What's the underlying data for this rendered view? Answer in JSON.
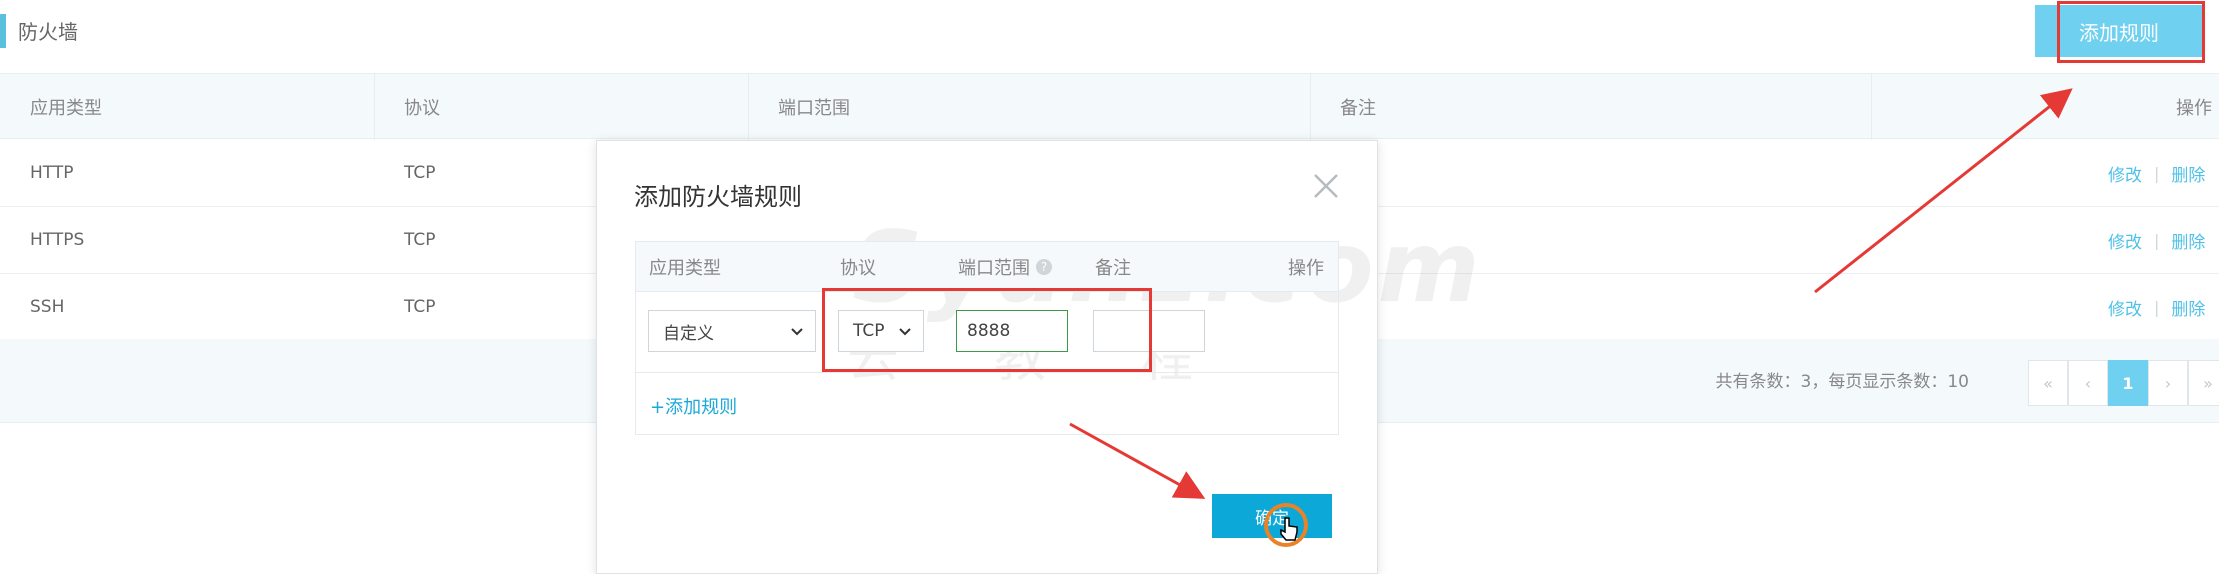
{
  "page": {
    "title": "防火墙"
  },
  "toolbar": {
    "add_rule_label": "添加规则"
  },
  "table": {
    "headers": [
      "应用类型",
      "协议",
      "端口范围",
      "备注",
      "操作"
    ],
    "rows": [
      {
        "app": "HTTP",
        "protocol": "TCP",
        "edit": "修改",
        "delete": "删除"
      },
      {
        "app": "HTTPS",
        "protocol": "TCP",
        "edit": "修改",
        "delete": "删除"
      },
      {
        "app": "SSH",
        "protocol": "TCP",
        "edit": "修改",
        "delete": "删除"
      }
    ],
    "action_separator": "|"
  },
  "pagination": {
    "info": "共有条数：3，每页显示条数：10",
    "first": "«",
    "prev": "‹",
    "current_page": "1",
    "next": "›",
    "last": "»"
  },
  "modal": {
    "title": "添加防火墙规则",
    "watermark": "Syunz.com",
    "watermark_sub": "云教程",
    "headers": [
      "应用类型",
      "协议",
      "端口范围",
      "备注",
      "操作"
    ],
    "help_glyph": "?",
    "row": {
      "app_type_value": "自定义",
      "protocol_value": "TCP",
      "port_value": "8888",
      "note_value": ""
    },
    "add_rule_link": "+添加规则",
    "confirm_label": "确定"
  },
  "colors": {
    "accent": "#6fd0ef",
    "confirm": "#0ba8d8",
    "annotation_red": "#e53935",
    "cursor_ring": "#e8832a"
  },
  "icons": [
    "close-icon",
    "chevron-down-icon",
    "question-icon",
    "hand-cursor-icon"
  ]
}
